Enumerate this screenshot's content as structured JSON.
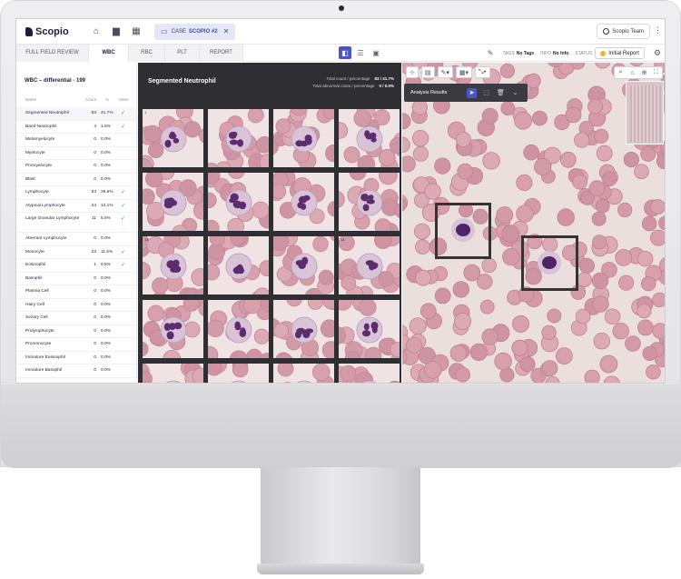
{
  "app": {
    "logo_text": "Scopio",
    "case_label": "CASE",
    "case_id": "SCOPIO #2",
    "user_name": "Scopio Team"
  },
  "tabs": [
    "FULL FIELD REVIEW",
    "WBC",
    "RBC",
    "PLT",
    "REPORT"
  ],
  "active_tab": "WBC",
  "toolbar": {
    "tags_label": "TAGS",
    "tags_value": "No Tags",
    "info_label": "INFO",
    "info_value": "No Info",
    "status_label": "STATUS",
    "status_value": "Initial Report",
    "status_color": "#f1b52c"
  },
  "differential": {
    "title": "WBC – differential - 199",
    "columns": [
      "Name",
      "Count",
      "%",
      "Seen"
    ],
    "rows": [
      {
        "name": "Segmented Neutrophil",
        "count": "83",
        "pct": "41.7%",
        "seen": true
      },
      {
        "name": "Band Neutrophil",
        "count": "3",
        "pct": "1.5%",
        "seen": true
      },
      {
        "name": "Metamyelocyte",
        "count": "0",
        "pct": "0.0%",
        "seen": false
      },
      {
        "name": "Myelocyte",
        "count": "0",
        "pct": "0.0%",
        "seen": false
      },
      {
        "name": "Promyelocyte",
        "count": "0",
        "pct": "0.0%",
        "seen": false
      },
      {
        "name": "Blast",
        "count": "0",
        "pct": "0.0%",
        "seen": false
      },
      {
        "name": "Lymphocyte",
        "count": "53",
        "pct": "26.6%",
        "seen": true
      },
      {
        "name": "Atypical Lymphocyte",
        "count": "24",
        "pct": "12.1%",
        "seen": true
      },
      {
        "name": "Large Granular Lymphocyte",
        "count": "11",
        "pct": "5.5%",
        "seen": true
      },
      {
        "name": "Aberrant Lymphocyte",
        "count": "0",
        "pct": "0.0%",
        "seen": false
      },
      {
        "name": "Monocyte",
        "count": "23",
        "pct": "11.6%",
        "seen": true
      },
      {
        "name": "Eosinophil",
        "count": "1",
        "pct": "0.5%",
        "seen": true
      },
      {
        "name": "Basophil",
        "count": "0",
        "pct": "0.0%",
        "seen": false
      },
      {
        "name": "Plasma Cell",
        "count": "0",
        "pct": "0.0%",
        "seen": false
      },
      {
        "name": "Hairy Cell",
        "count": "0",
        "pct": "0.0%",
        "seen": false
      },
      {
        "name": "Sezary Cell",
        "count": "0",
        "pct": "0.0%",
        "seen": false
      },
      {
        "name": "Prolymphocyte",
        "count": "0",
        "pct": "0.0%",
        "seen": false
      },
      {
        "name": "Promonocyte",
        "count": "0",
        "pct": "0.0%",
        "seen": false
      },
      {
        "name": "Immature Eosinophil",
        "count": "0",
        "pct": "0.0%",
        "seen": false
      },
      {
        "name": "Immature Basophil",
        "count": "0",
        "pct": "0.0%",
        "seen": false
      }
    ]
  },
  "gallery": {
    "title": "Segmented Neutrophil",
    "total_count_label": "Total count  /  percentage",
    "total_count_value": "83 /  41.7%",
    "abnormal_label": "Total abnormal count  /  percentage",
    "abnormal_value": "0 /   0.0%",
    "tile_numbers": [
      "1",
      "",
      "",
      "",
      "",
      "",
      "",
      "",
      "13",
      "",
      "",
      "14"
    ]
  },
  "viewer": {
    "analysis_label": "Analysis Results"
  },
  "icons": {
    "home": "home-icon",
    "folder": "folder-icon",
    "calendar": "calendar-icon",
    "settings": "gear-icon"
  }
}
